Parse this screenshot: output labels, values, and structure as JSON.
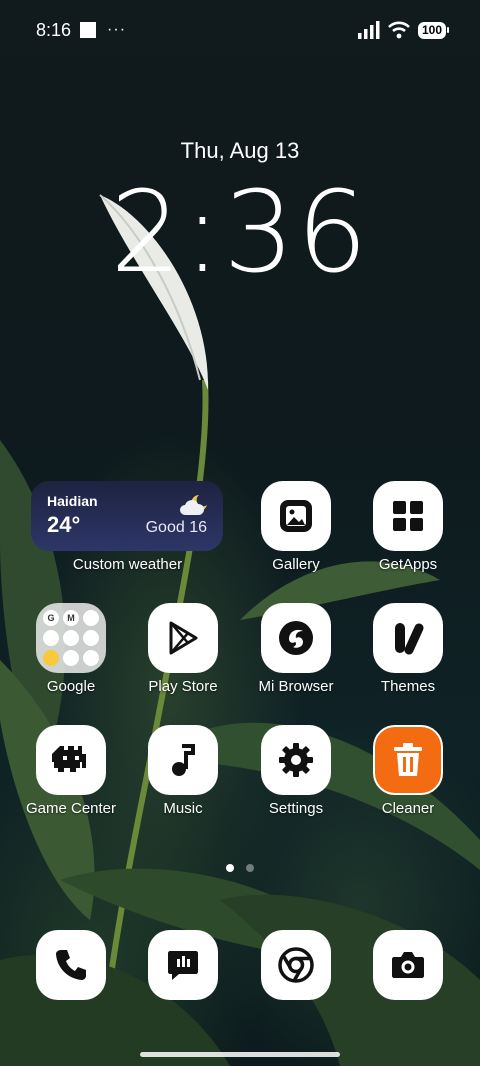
{
  "status_bar": {
    "time": "8:16",
    "dots": "···",
    "battery": "100"
  },
  "clock": {
    "date": "Thu, Aug 13",
    "time": "2:36"
  },
  "weather_widget": {
    "city": "Haidian",
    "temperature": "24°",
    "air_quality": "Good 16",
    "label": "Custom weather"
  },
  "apps": {
    "gallery": "Gallery",
    "getapps": "GetApps",
    "google": "Google",
    "play_store": "Play Store",
    "mi_browser": "Mi Browser",
    "themes": "Themes",
    "game_center": "Game Center",
    "music": "Music",
    "settings": "Settings",
    "cleaner": "Cleaner"
  },
  "google_folder_letters": [
    "G",
    "M",
    "",
    "",
    "",
    "",
    "",
    "",
    ""
  ],
  "dock": [
    "phone-icon",
    "messaging-icon",
    "chrome-icon",
    "camera-icon"
  ],
  "colors": {
    "cleaner": "#f36c12",
    "weather_bg": "#2e3668"
  }
}
